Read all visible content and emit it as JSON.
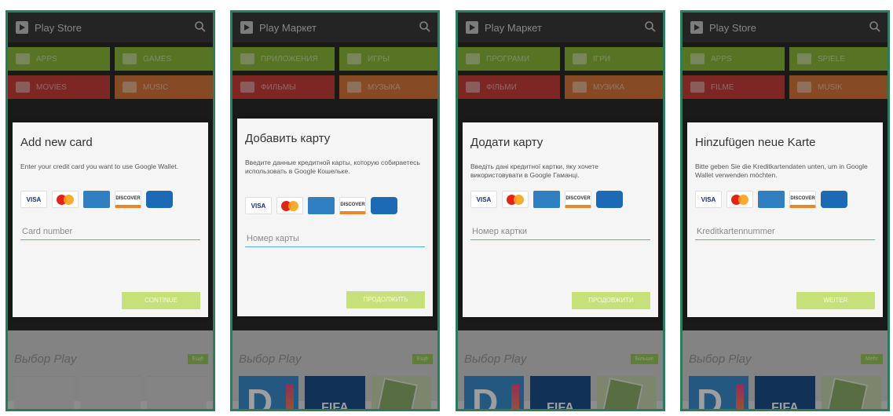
{
  "colors": {
    "frame": "#2f7a5a",
    "action_bar": "#3b3b3b",
    "tile_green": "#8dbb3d",
    "tile_red": "#c9403a",
    "tile_orange": "#d9783a",
    "button_green": "#c8e07a",
    "input_underline": "#4fb1d8"
  },
  "phones": [
    {
      "store_title": "Play Store",
      "tiles": [
        "Apps",
        "Games",
        "Movies",
        "Music"
      ],
      "dialog": {
        "title": "Add new card",
        "description": "Enter your credit card you want to use Google Wallet.",
        "card_placeholder": "Card number",
        "continue_label": "Continue"
      },
      "featured_title": "Выбор Play",
      "more_label": "Ещё"
    },
    {
      "store_title": "Play Маркет",
      "tiles": [
        "Приложения",
        "Игры",
        "Фильмы",
        "Музыка"
      ],
      "dialog": {
        "title": "Добавить карту",
        "description": "Введите данные кредитной карты, которую собираетесь использовать в Google Кошельке.",
        "card_placeholder": "Номер карты",
        "continue_label": "Продолжить"
      },
      "featured_title": "Выбор Play",
      "more_label": "Ещё"
    },
    {
      "store_title": "Play Маркет",
      "tiles": [
        "Програми",
        "Ігри",
        "Фільми",
        "Музика"
      ],
      "dialog": {
        "title": "Додати карту",
        "description": "Введіть дані кредитної картки, яку хочете використовувати в Google Гаманці.",
        "card_placeholder": "Номер картки",
        "continue_label": "Продовжити"
      },
      "featured_title": "Выбор Play",
      "more_label": "Більше"
    },
    {
      "store_title": "Play Store",
      "tiles": [
        "Apps",
        "Spiele",
        "Filme",
        "Musik"
      ],
      "dialog": {
        "title": "Hinzufügen neue Karte",
        "description": "Bitte geben Sie die Kreditkartendaten unten, um in Google Wallet verwenden möchten.",
        "card_placeholder": "Kreditkartennummer",
        "continue_label": "Weiter"
      },
      "featured_title": "Выбор Play",
      "more_label": "Mehr"
    }
  ],
  "cards": [
    "VISA",
    "MasterCard",
    "American Express",
    "DISCOVER",
    "Discover network"
  ],
  "icons": [
    "store-icon",
    "search-icon",
    "apps-icon",
    "games-icon",
    "movies-icon",
    "music-icon"
  ]
}
